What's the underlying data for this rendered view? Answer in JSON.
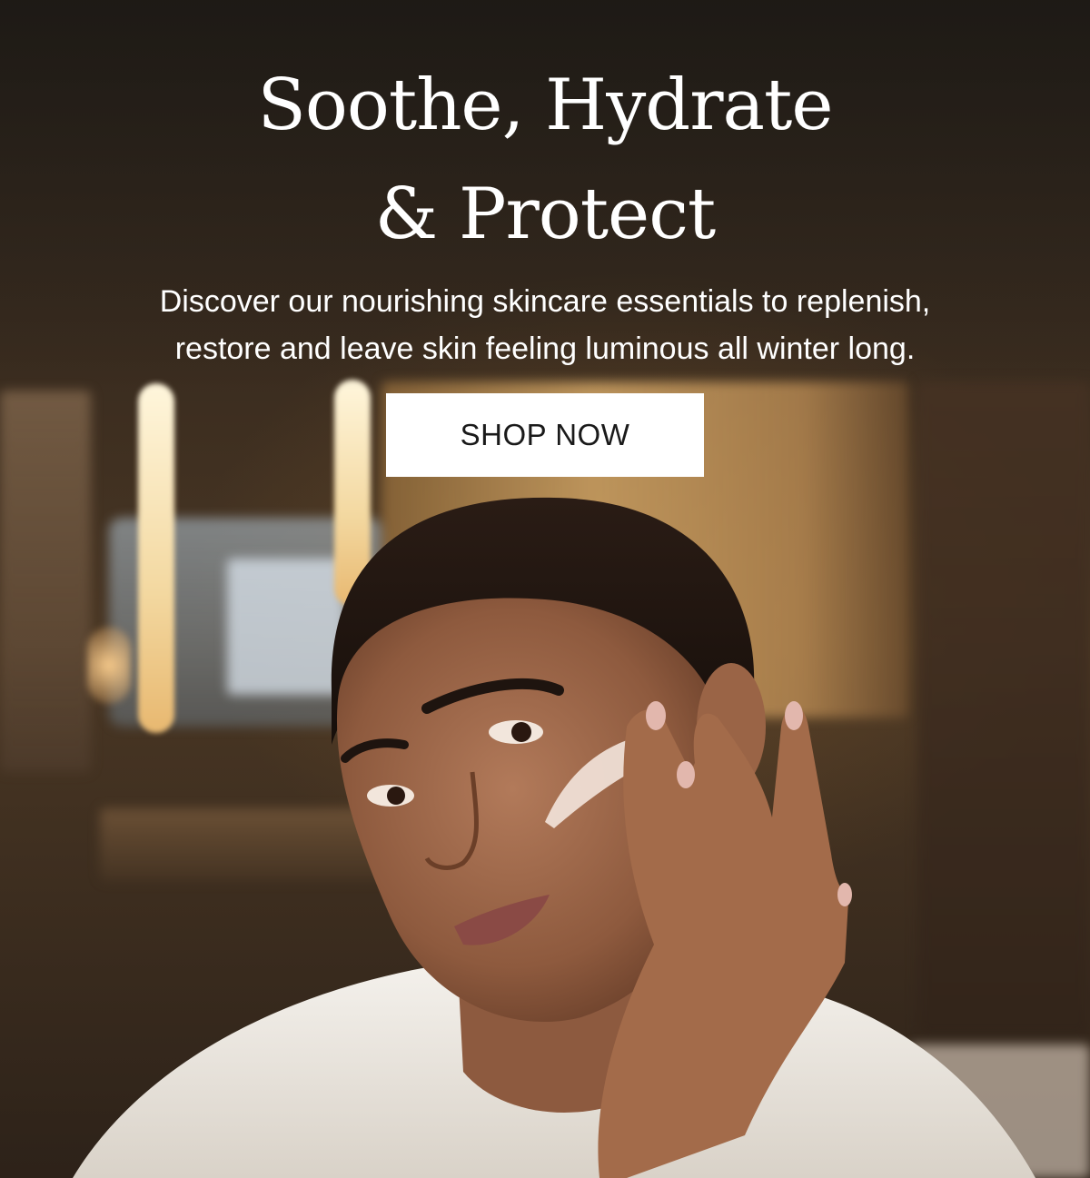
{
  "banner": {
    "headline_line1": "Soothe, Hydrate",
    "headline_line2": "& Protect",
    "subtext_line1": "Discover our nourishing skincare essentials to replenish,",
    "subtext_line2": "restore and leave skin feeling luminous all winter long.",
    "cta_label": "SHOP NOW"
  },
  "colors": {
    "text": "#ffffff",
    "button_bg": "#ffffff",
    "button_text": "#1a1a1a"
  }
}
